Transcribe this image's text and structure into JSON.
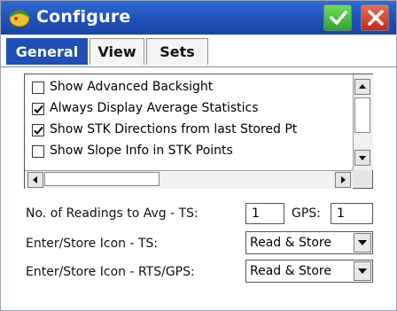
{
  "window": {
    "title": "Configure",
    "accent": "#1d4fb4",
    "ok_icon": "check-icon",
    "close_icon": "close-icon"
  },
  "tabs": [
    {
      "label": "General",
      "active": true
    },
    {
      "label": "View",
      "active": false
    },
    {
      "label": "Sets",
      "active": false
    }
  ],
  "options": [
    {
      "label": "Show Advanced Backsight",
      "checked": false
    },
    {
      "label": "Always Display Average Statistics",
      "checked": true
    },
    {
      "label": "Show STK Directions from last Stored Pt",
      "checked": true
    },
    {
      "label": "Show Slope Info in STK Points",
      "checked": false
    }
  ],
  "readings": {
    "label": "No. of Readings to Avg  -  TS:",
    "ts_value": "1",
    "gps_label": "GPS:",
    "gps_value": "1"
  },
  "icon_ts": {
    "label": "Enter/Store Icon - TS:",
    "value": "Read & Store"
  },
  "icon_rts_gps": {
    "label": "Enter/Store Icon - RTS/GPS:",
    "value": "Read & Store"
  }
}
